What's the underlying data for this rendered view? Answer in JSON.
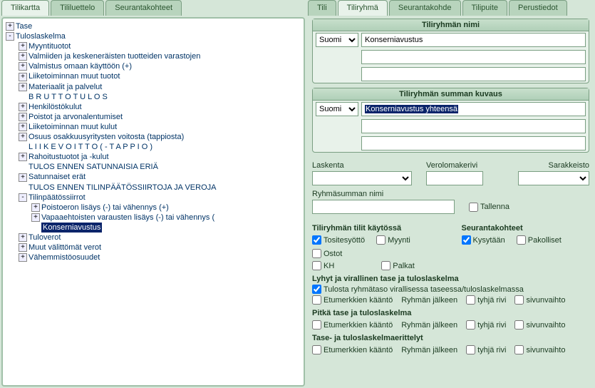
{
  "leftTabs": [
    "Tilikartta",
    "Tililuettelo",
    "Seurantakohteet"
  ],
  "leftActiveTab": 0,
  "rightTabs": [
    "Tili",
    "Tiliryhmä",
    "Seurantakohde",
    "Tilipuite",
    "Perustiedot"
  ],
  "rightActiveTab": 1,
  "tree": [
    {
      "icon": "+",
      "label": "Tase",
      "indent": 0
    },
    {
      "icon": "-",
      "label": "Tuloslaskelma",
      "indent": 0
    },
    {
      "icon": "+",
      "label": "Myyntituotot",
      "indent": 1
    },
    {
      "icon": "+",
      "label": "Valmiiden ja keskeneräisten tuotteiden varastojen",
      "indent": 1
    },
    {
      "icon": "+",
      "label": "Valmistus omaan käyttöön (+)",
      "indent": 1
    },
    {
      "icon": "+",
      "label": "Liiketoiminnan muut tuotot",
      "indent": 1
    },
    {
      "icon": "+",
      "label": "Materiaalit ja palvelut",
      "indent": 1
    },
    {
      "icon": "",
      "label": "B R U T T O T U L O S",
      "indent": 1
    },
    {
      "icon": "+",
      "label": "Henkilöstökulut",
      "indent": 1
    },
    {
      "icon": "+",
      "label": "Poistot ja arvonalentumiset",
      "indent": 1
    },
    {
      "icon": "+",
      "label": "Liiketoiminnan muut kulut",
      "indent": 1
    },
    {
      "icon": "+",
      "label": "Osuus osakkuusyritysten voitosta (tappiosta)",
      "indent": 1
    },
    {
      "icon": "",
      "label": "L I I K E V O I T T O   ( - T A P P I O )",
      "indent": 1
    },
    {
      "icon": "+",
      "label": "Rahoitustuotot ja -kulut",
      "indent": 1
    },
    {
      "icon": "",
      "label": "TULOS ENNEN SATUNNAISIA ERIÄ",
      "indent": 1
    },
    {
      "icon": "+",
      "label": "Satunnaiset erät",
      "indent": 1
    },
    {
      "icon": "",
      "label": "TULOS ENNEN TILINPÄÄTÖSSIIRTOJA  JA VEROJA",
      "indent": 1
    },
    {
      "icon": "-",
      "label": "Tilinpäätössiirrot",
      "indent": 1
    },
    {
      "icon": "+",
      "label": "Poistoeron lisäys (-) tai vähennys (+)",
      "indent": 2
    },
    {
      "icon": "+",
      "label": "Vapaaehtoisten varausten lisäys (-) tai vähennys (",
      "indent": 2
    },
    {
      "icon": "",
      "label": "Konserniavustus",
      "indent": 2,
      "selected": true
    },
    {
      "icon": "+",
      "label": "Tuloverot",
      "indent": 1
    },
    {
      "icon": "+",
      "label": "Muut välittömät verot",
      "indent": 1
    },
    {
      "icon": "+",
      "label": "Vähemmistöosuudet",
      "indent": 1
    }
  ],
  "form": {
    "sec1": {
      "title": "Tiliryhmän nimi",
      "lang": "Suomi",
      "val": "Konserniavustus"
    },
    "sec2": {
      "title": "Tiliryhmän summan kuvaus",
      "lang": "Suomi",
      "val": "Konserniavustus yhteensä"
    },
    "labels": {
      "laskenta": "Laskenta",
      "verolomakerivi": "Verolomakerivi",
      "sarakkeisto": "Sarakkeisto",
      "ryhmasumman": "Ryhmäsumman nimi",
      "tallenna": "Tallenna"
    },
    "accounts": {
      "title": "Tiliryhmän tilit käytössä",
      "tositesyotto": "Tositesyöttö",
      "myynti": "Myynti",
      "ostot": "Ostot",
      "kh": "KH",
      "palkat": "Palkat"
    },
    "seuranta": {
      "title": "Seurantakohteet",
      "kysytaan": "Kysytään",
      "pakolliset": "Pakolliset"
    },
    "lyhyt": {
      "title": "Lyhyt ja virallinen tase ja tuloslaskelma",
      "tulosta": "Tulosta ryhmätaso virallisessa taseessa/tuloslaskelmassa"
    },
    "pitka": {
      "title": "Pitkä tase ja tuloslaskelma"
    },
    "erittelyt": {
      "title": "Tase- ja tuloslaskelmaerittelyt"
    },
    "common": {
      "etumerkki": "Etumerkkien kääntö",
      "ryhmanJalkeen": "Ryhmän jälkeen",
      "tyhjaRivi": "tyhjä rivi",
      "sivunvaihto": "sivunvaihto"
    }
  }
}
